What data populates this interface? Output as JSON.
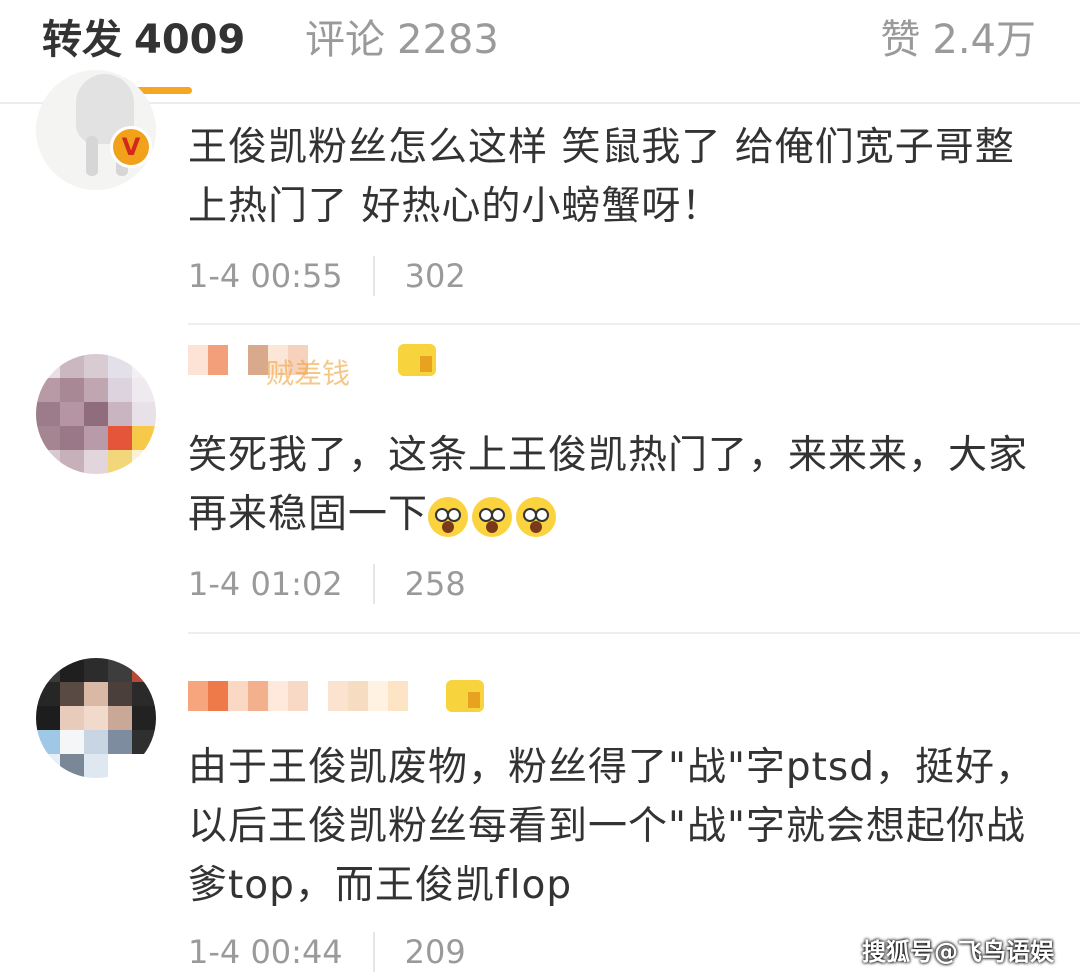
{
  "tabs": {
    "repost": {
      "label": "转发",
      "count": "4009"
    },
    "comment": {
      "label": "评论",
      "count": "2283"
    },
    "like": {
      "label": "赞",
      "count": "2.4万"
    }
  },
  "comments": [
    {
      "text": "王俊凯粉丝怎么这样  笑鼠我了  给俺们宽子哥整上热门了   好热心的小螃蟹呀！",
      "time": "1-4 00:55",
      "likes": "302",
      "verified_badge": "V"
    },
    {
      "username": "贼差钱",
      "text": "笑死我了，这条上王俊凯热门了，来来来，大家再来稳固一下",
      "time": "1-4 01:02",
      "likes": "258"
    },
    {
      "text": "由于王俊凯废物，粉丝得了\"战\"字ptsd，挺好，以后王俊凯粉丝每看到一个\"战\"字就会想起你战爹top，而王俊凯flop",
      "time": "1-4 00:44",
      "likes": "209"
    }
  ],
  "watermark": "搜狐号@飞鸟语娱",
  "colors": {
    "accent": "#f7a624",
    "text": "#333333",
    "muted": "#9a9a9a",
    "divider": "#eeeeee"
  }
}
